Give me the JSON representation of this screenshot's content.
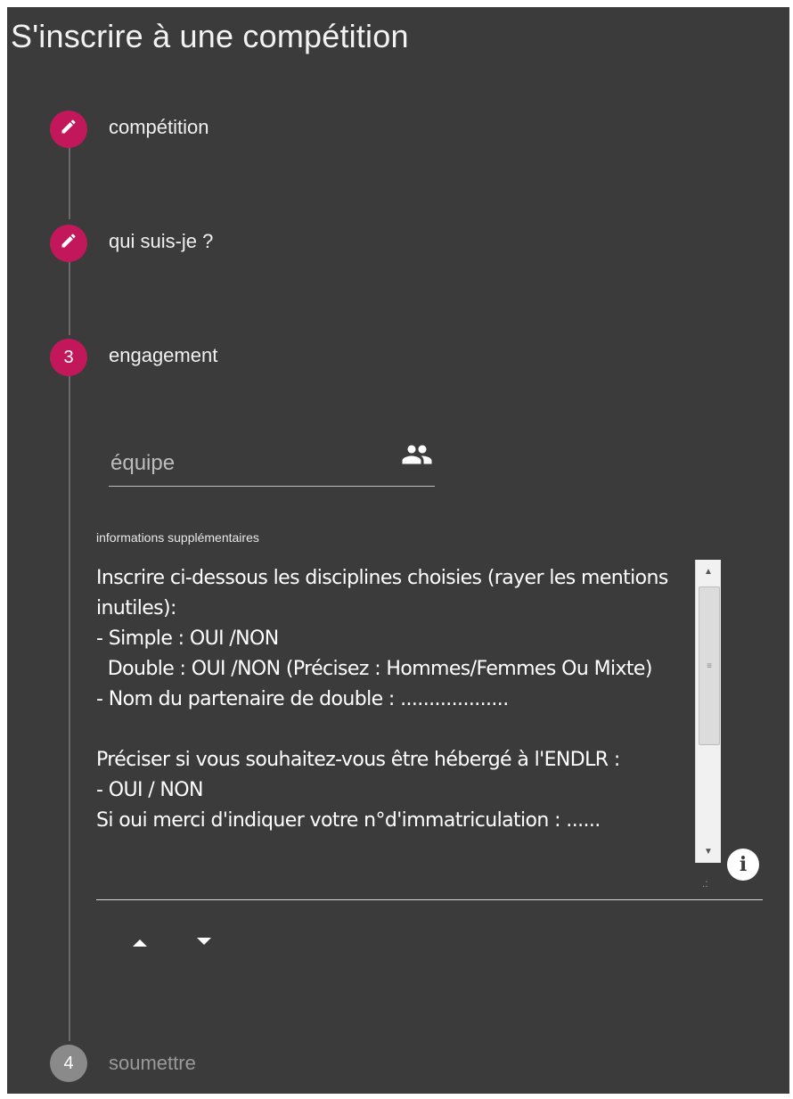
{
  "page": {
    "title": "S'inscrire à une compétition"
  },
  "steps": [
    {
      "indicator": "edit-icon",
      "label": "compétition",
      "state": "completed"
    },
    {
      "indicator": "edit-icon",
      "label": "qui suis-je ?",
      "state": "completed"
    },
    {
      "indicator": "3",
      "label": "engagement",
      "state": "active"
    },
    {
      "indicator": "4",
      "label": "soumettre",
      "state": "inactive"
    }
  ],
  "engagement": {
    "team_field": {
      "placeholder": "équipe",
      "value": "",
      "icon": "group-icon"
    },
    "additional_info": {
      "label": "informations supplémentaires",
      "value": "Inscrire ci-dessous les disciplines choisies (rayer les mentions inutiles):\n- Simple : OUI /NON\n  Double : OUI /NON (Précisez : Hommes/Femmes Ou Mixte)\n- Nom du partenaire de double : ...................\n\nPréciser si vous souhaitez-vous être hébergé à l'ENDLR :\n- OUI / NON\nSi oui merci d'indiquer votre n°d'immatriculation : ......"
    },
    "info_icon": "info-icon",
    "move_up_icon": "arrow-up-icon",
    "move_down_icon": "arrow-down-icon"
  },
  "colors": {
    "background": "#3b3b3b",
    "accent": "#c2185b",
    "inactive_step": "#8a8a8a"
  }
}
